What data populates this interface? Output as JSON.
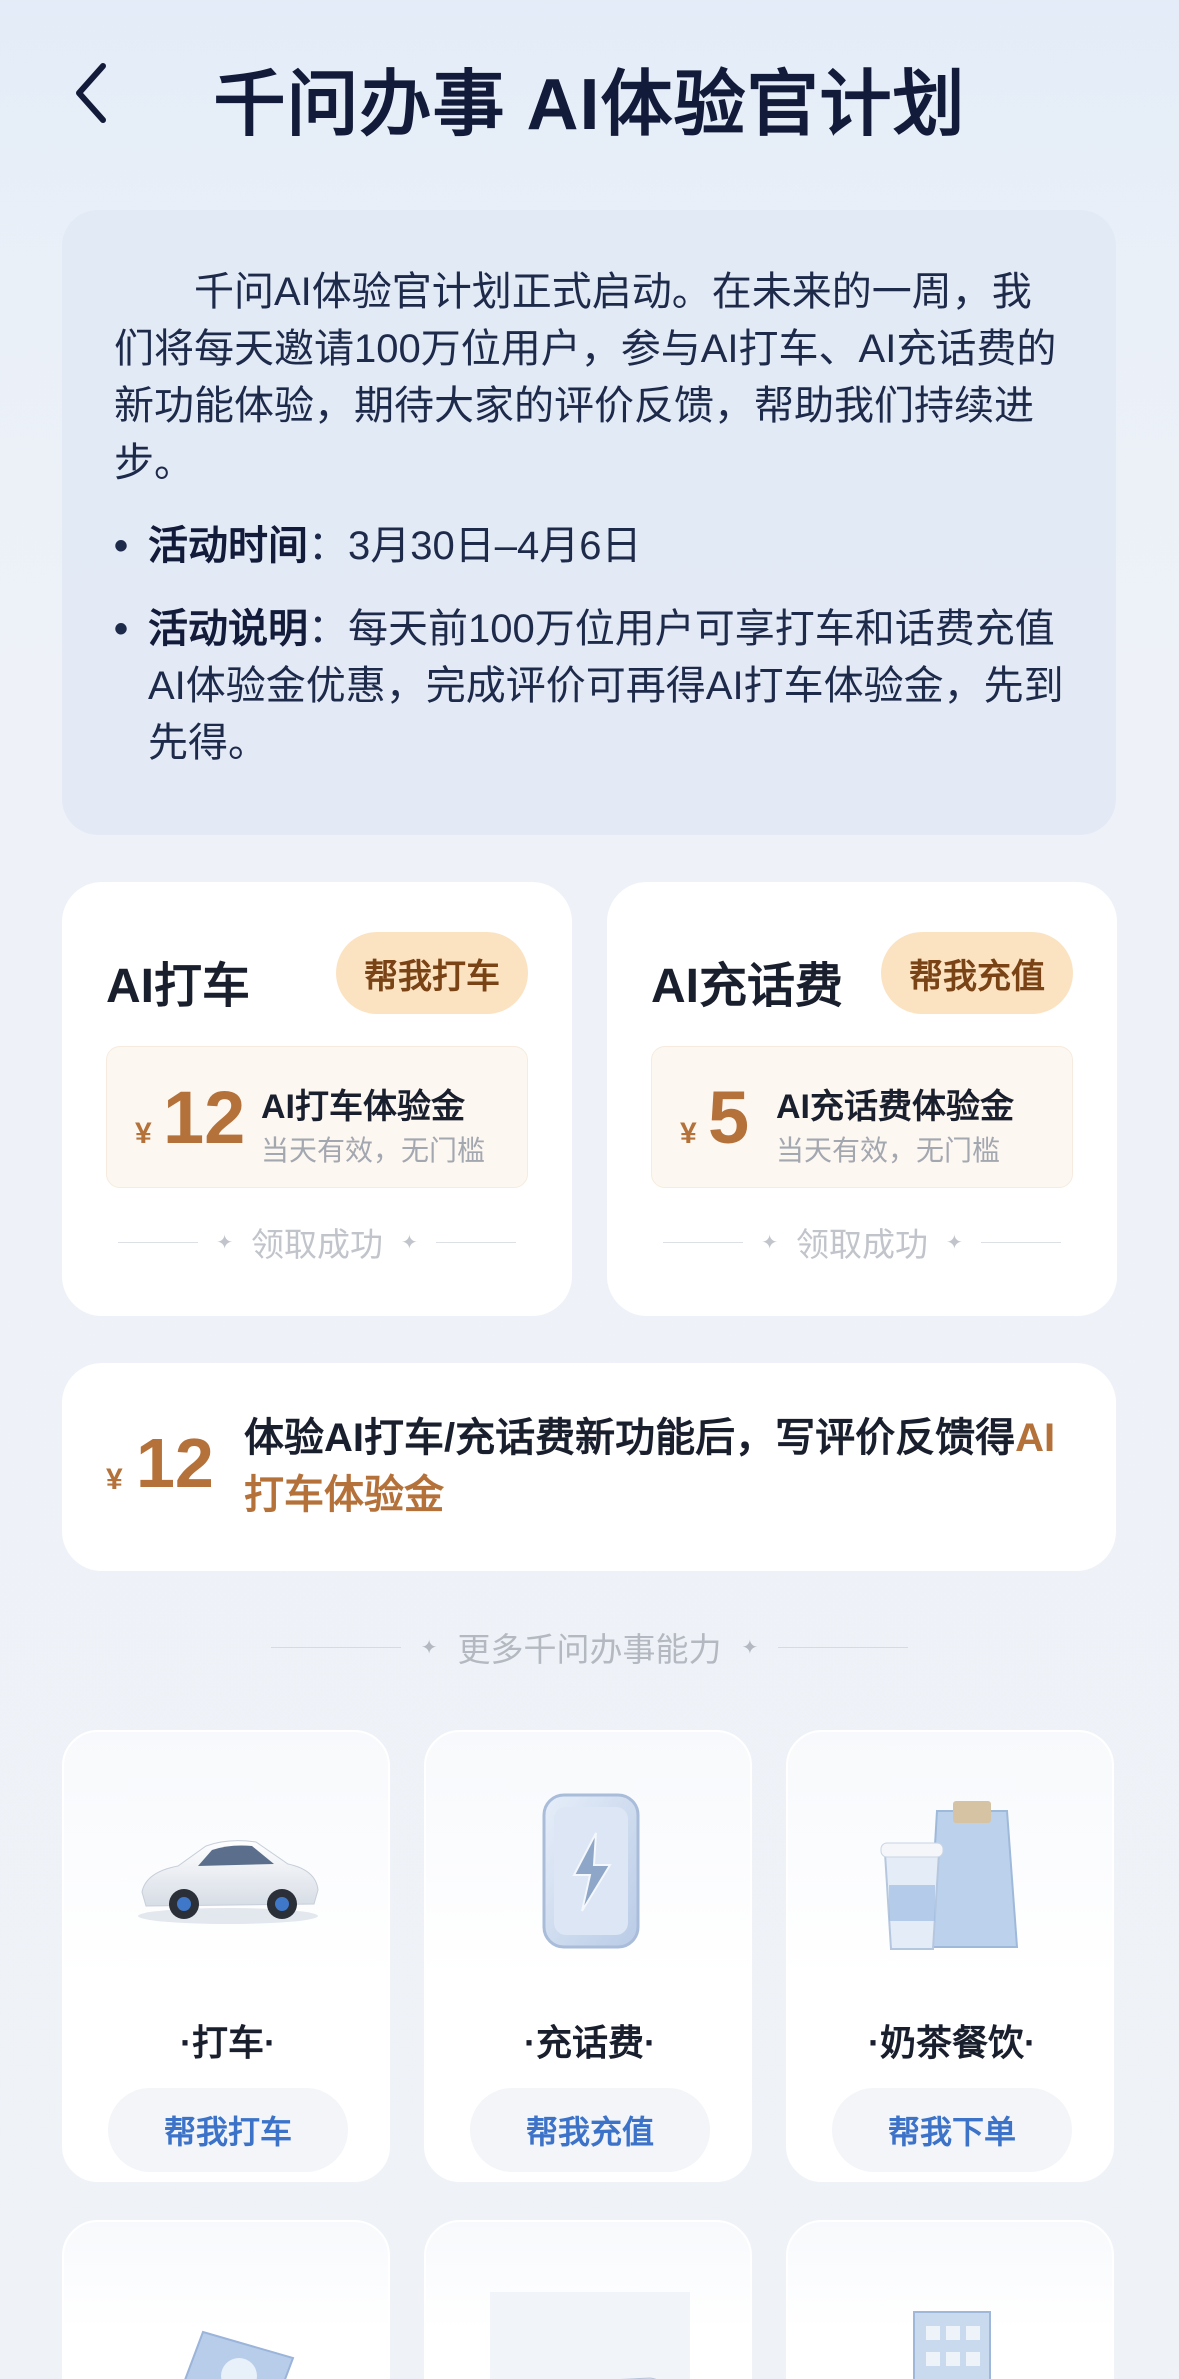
{
  "header": {
    "title": "千问办事 AI体验官计划"
  },
  "intro": {
    "lead": "千问AI体验官计划正式启动。在未来的一周，我们将每天邀请100万位用户，参与AI打车、AI充话费的新功能体验，期待大家的评价反馈，帮助我们持续进步。",
    "time_label": "活动时间",
    "time_value": "：3月30日–4月6日",
    "desc_label": "活动说明",
    "desc_value": "：每天前100万位用户可享打车和话费充值AI体验金优惠，完成评价可再得AI打车体验金，先到先得。",
    "bullet": "•"
  },
  "ride_card": {
    "title": "AI打车",
    "button": "帮我打车",
    "yen": "¥",
    "amount": "12",
    "coupon_name": "AI打车体验金",
    "coupon_desc": "当天有效，无门槛",
    "status": "领取成功"
  },
  "phone_card": {
    "title": "AI充话费",
    "button": "帮我充值",
    "yen": "¥",
    "amount": "5",
    "coupon_name": "AI充话费体验金",
    "coupon_desc": "当天有效，无门槛",
    "status": "领取成功"
  },
  "review_card": {
    "yen": "¥",
    "amount": "12",
    "text": "体验AI打车/充话费新功能后，写评价反馈得",
    "highlight": "AI打车体验金"
  },
  "more_section": {
    "title": "更多千问办事能力"
  },
  "services": [
    {
      "name": "·打车·",
      "button": "帮我打车",
      "icon": "car-icon"
    },
    {
      "name": "·充话费·",
      "button": "帮我充值",
      "icon": "phone-charge-icon"
    },
    {
      "name": "·奶茶餐饮·",
      "button": "帮我下单",
      "icon": "milk-tea-icon"
    }
  ],
  "colors": {
    "accent_gold": "#b5713a",
    "pill_bg": "#fbe3c2",
    "link_blue": "#3c73c9"
  }
}
